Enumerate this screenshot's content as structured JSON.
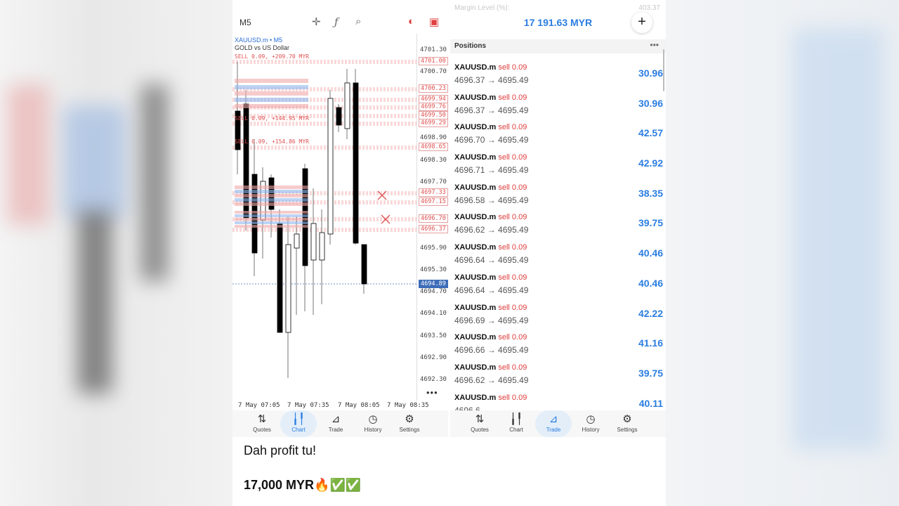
{
  "chart_panel": {
    "timeframe": "M5",
    "toolbar_icons": [
      "crosshair-icon",
      "function-icon",
      "objects-icon",
      "colors-icon",
      "one-click-icon"
    ],
    "symbol_line": "XAUUSD.m • M5",
    "symbol_desc": "GOLD vs US Dollar",
    "trade_label_top": "SELL 0.09, +209.70 MYR",
    "trade_label_mid": "SELL 0.09, +144.95 MYR",
    "trade_label_low": "SELL 0.09, +154.86 MYR",
    "y_ticks": [
      "4701.30",
      "4700.70",
      "4698.90",
      "4698.30",
      "4697.70",
      "4695.90",
      "4695.30",
      "4694.70",
      "4694.10",
      "4693.50",
      "4692.90",
      "4692.30"
    ],
    "y_tags": [
      "4701.00",
      "4700.23",
      "4699.94",
      "4699.76",
      "4699.50",
      "4699.29",
      "4698.65",
      "4697.33",
      "4697.15",
      "4696.70",
      "4696.37"
    ],
    "current_price": "4694.89",
    "x_ticks": [
      "7 May 07:05",
      "7 May 07:35",
      "7 May 08:05",
      "7 May 08:35"
    ],
    "more": "•••"
  },
  "nav_left": [
    {
      "label": "Quotes",
      "icon": "quotes-icon",
      "glyph": "⇅"
    },
    {
      "label": "Chart",
      "icon": "chart-icon",
      "glyph": "╽╿"
    },
    {
      "label": "Trade",
      "icon": "trade-icon",
      "glyph": "⊿"
    },
    {
      "label": "History",
      "icon": "history-icon",
      "glyph": "◷"
    },
    {
      "label": "Settings",
      "icon": "settings-icon",
      "glyph": "⚙"
    }
  ],
  "nav_right": [
    {
      "label": "Quotes",
      "icon": "quotes-icon",
      "glyph": "⇅"
    },
    {
      "label": "Chart",
      "icon": "chart-icon",
      "glyph": "╽╿"
    },
    {
      "label": "Trade",
      "icon": "trade-icon",
      "glyph": "⊿"
    },
    {
      "label": "History",
      "icon": "history-icon",
      "glyph": "◷"
    },
    {
      "label": "Settings",
      "icon": "settings-icon",
      "glyph": "⚙"
    }
  ],
  "trade_panel": {
    "ghost_left": "Margin Level (%):",
    "ghost_right": "403.37",
    "balance": "17 191.63 MYR",
    "plus": "+",
    "positions_title": "Positions",
    "positions_more": "•••",
    "positions": [
      {
        "symbol": "XAUUSD.m",
        "side": "sell 0.09",
        "prices": "4696.37 → 4695.49",
        "profit": "30.96"
      },
      {
        "symbol": "XAUUSD.m",
        "side": "sell 0.09",
        "prices": "4696.37 → 4695.49",
        "profit": "30.96"
      },
      {
        "symbol": "XAUUSD.m",
        "side": "sell 0.09",
        "prices": "4696.70 → 4695.49",
        "profit": "42.57"
      },
      {
        "symbol": "XAUUSD.m",
        "side": "sell 0.09",
        "prices": "4696.71 → 4695.49",
        "profit": "42.92"
      },
      {
        "symbol": "XAUUSD.m",
        "side": "sell 0.09",
        "prices": "4696.58 → 4695.49",
        "profit": "38.35"
      },
      {
        "symbol": "XAUUSD.m",
        "side": "sell 0.09",
        "prices": "4696.62 → 4695.49",
        "profit": "39.75"
      },
      {
        "symbol": "XAUUSD.m",
        "side": "sell 0.09",
        "prices": "4696.64 → 4695.49",
        "profit": "40.46"
      },
      {
        "symbol": "XAUUSD.m",
        "side": "sell 0.09",
        "prices": "4696.64 → 4695.49",
        "profit": "40.46"
      },
      {
        "symbol": "XAUUSD.m",
        "side": "sell 0.09",
        "prices": "4696.69 → 4695.49",
        "profit": "42.22"
      },
      {
        "symbol": "XAUUSD.m",
        "side": "sell 0.09",
        "prices": "4696.66 → 4695.49",
        "profit": "41.16"
      },
      {
        "symbol": "XAUUSD.m",
        "side": "sell 0.09",
        "prices": "4696.62 → 4695.49",
        "profit": "39.75"
      },
      {
        "symbol": "XAUUSD.m",
        "side": "sell 0.09",
        "prices": "4696.6…",
        "profit": "40.11"
      }
    ]
  },
  "caption": {
    "line1": "Dah profit tu!",
    "line2": "17,000 MYR🔥✅✅"
  },
  "colors": {
    "accent": "#2a7de1",
    "sell": "#e03c3c",
    "candle_bull": "#ffffff",
    "candle_bear": "#000000"
  }
}
